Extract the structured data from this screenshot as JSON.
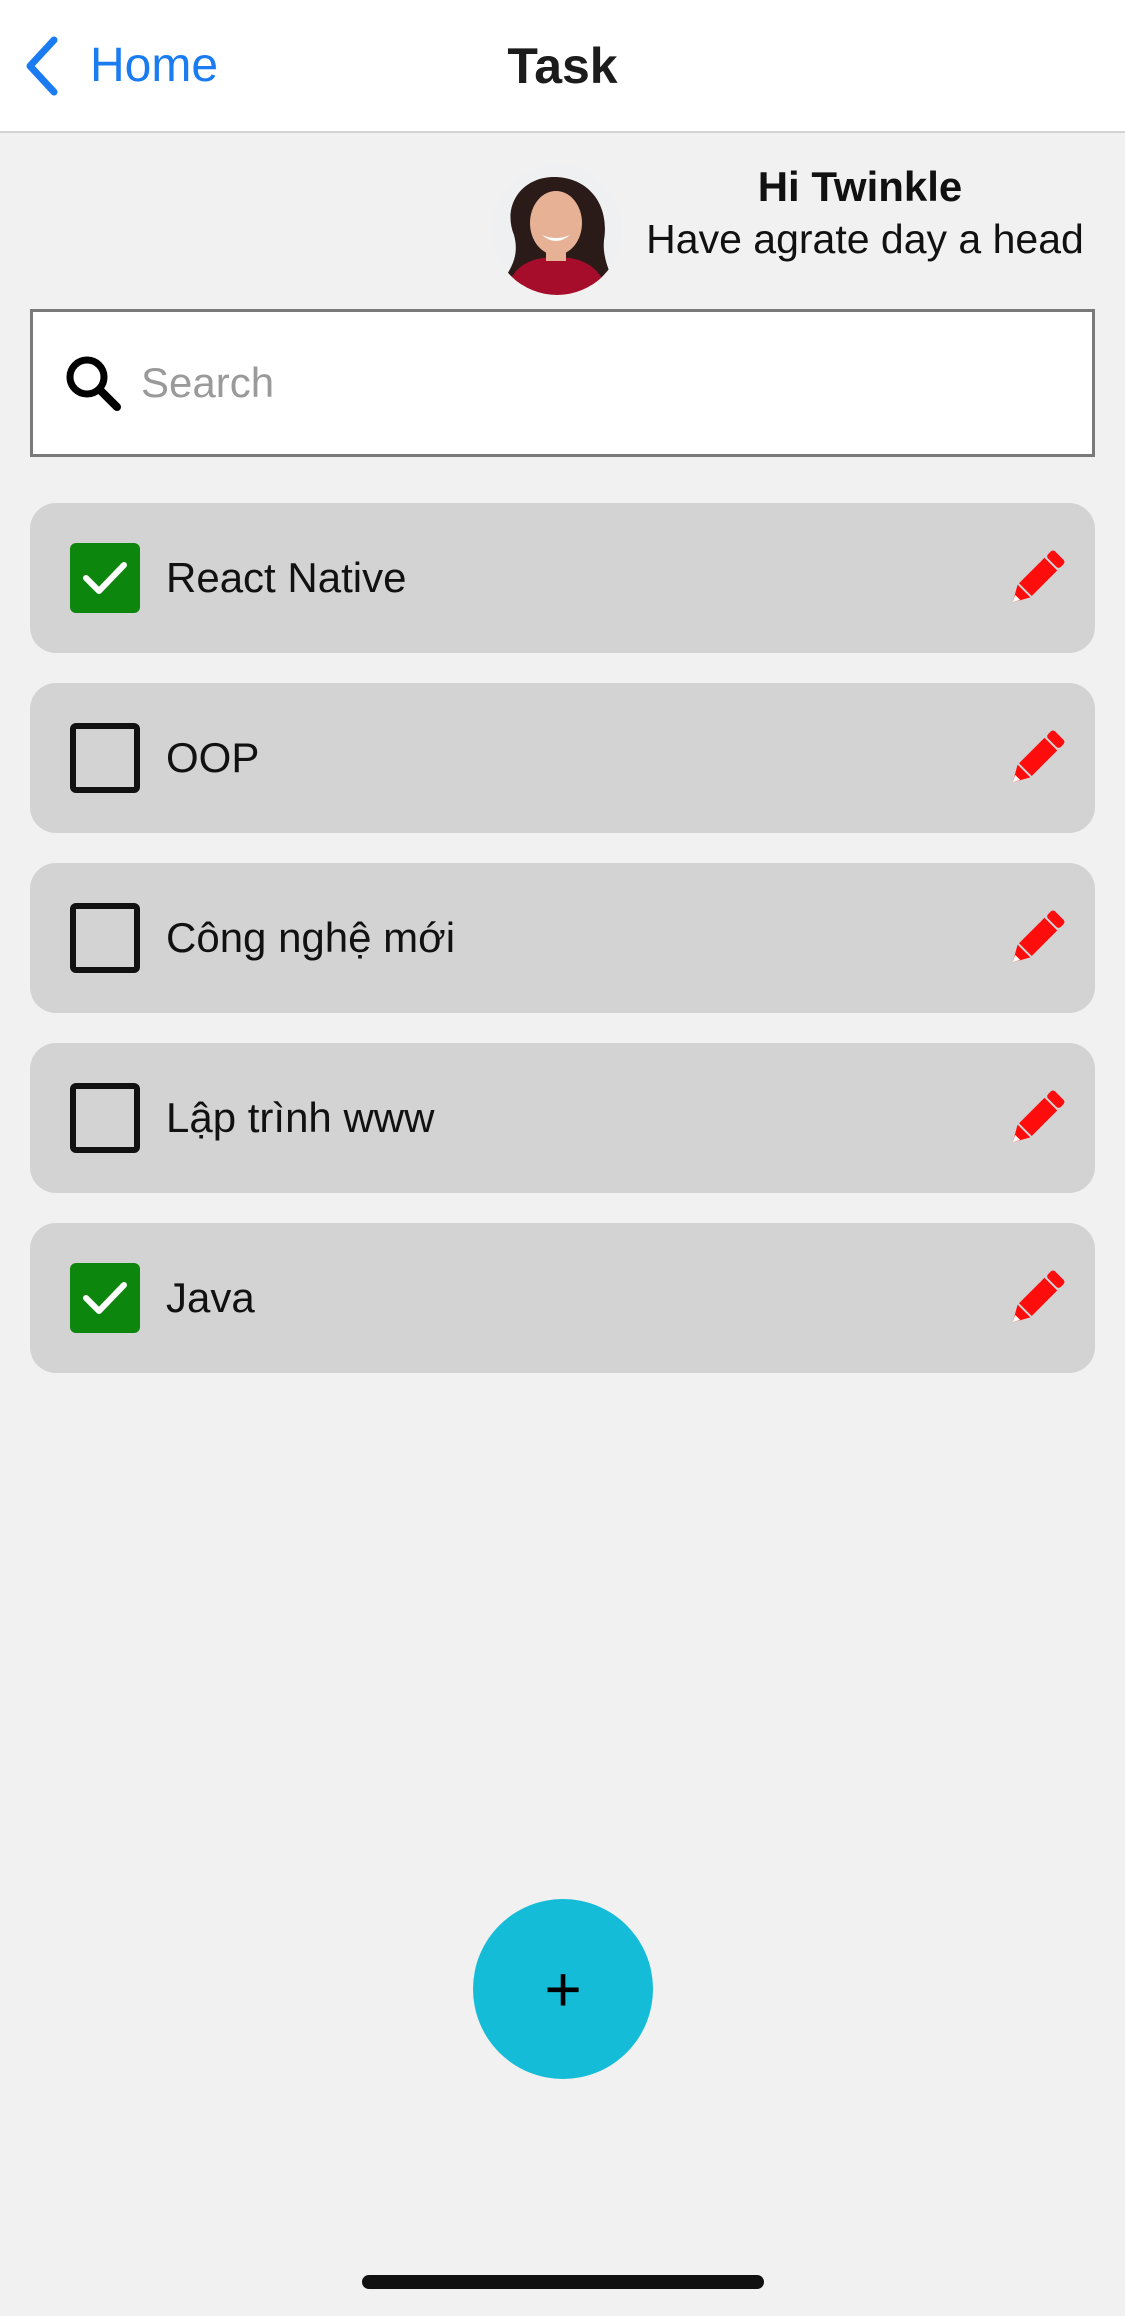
{
  "nav": {
    "back_label": "Home",
    "title": "Task",
    "back_icon": "chevron-left-icon",
    "accent_color": "#1a7cf0"
  },
  "greeting": {
    "name": "Hi Twinkle",
    "subtitle": "Have agrate day a head",
    "avatar_icon": "avatar"
  },
  "search": {
    "placeholder": "Search",
    "value": "",
    "icon": "search-icon"
  },
  "tasks": [
    {
      "label": "React Native",
      "done": true
    },
    {
      "label": "OOP",
      "done": false
    },
    {
      "label": "Công nghệ mới",
      "done": false
    },
    {
      "label": "Lập trình www",
      "done": false
    },
    {
      "label": "Java",
      "done": true
    }
  ],
  "colors": {
    "checked": "#0d860d",
    "edit_icon": "#ff0d0d",
    "fab": "#14bcd7",
    "task_bg": "#d3d3d3"
  },
  "fab": {
    "label": "+"
  }
}
